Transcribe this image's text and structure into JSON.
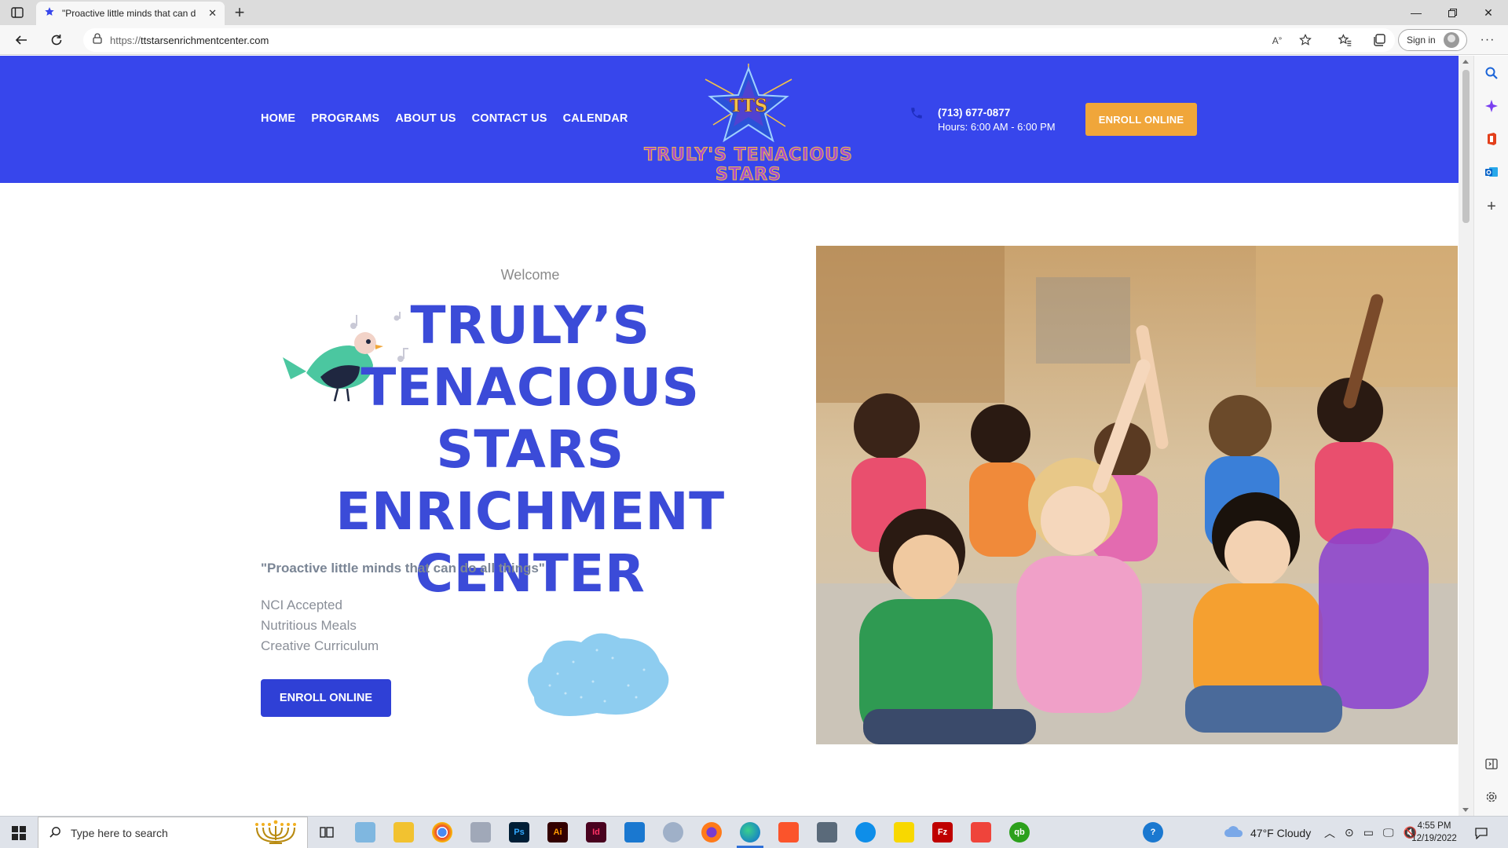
{
  "browser": {
    "tab_title": "\"Proactive little minds that can d",
    "url_host": "ttstarsenrichmentcenter.com",
    "url_scheme": "https://",
    "sign_in": "Sign in",
    "new_tab": "+"
  },
  "site": {
    "nav": [
      "HOME",
      "PROGRAMS",
      "ABOUT US",
      "CONTACT US",
      "CALENDAR"
    ],
    "logo_text": "TRULY'S TENACIOUS STARS",
    "logo_monogram": "TTS",
    "phone": "(713) 677-0877",
    "hours": "Hours: 6:00 AM - 6:00 PM",
    "header_enroll": "ENROLL ONLINE",
    "colors": {
      "header_bg": "#3746ec",
      "title": "#3b4bd8",
      "enroll_orange": "#f0a63a",
      "enroll_blue": "#2f40d6"
    }
  },
  "hero": {
    "welcome": "Welcome",
    "title_lines": [
      "TRULY’S",
      "TENACIOUS STARS",
      "ENRICHMENT",
      "CENTER"
    ],
    "tagline": "\"Proactive little minds that can do all things\"",
    "features": [
      "NCI Accepted",
      "Nutritious Meals",
      "Creative Curriculum"
    ],
    "enroll": "ENROLL ONLINE"
  },
  "taskbar": {
    "search_placeholder": "Type here to search",
    "weather": "47°F  Cloudy",
    "time": "4:55 PM",
    "date": "12/19/2022",
    "apps": [
      "task-view",
      "notepad",
      "file-explorer",
      "chrome",
      "quill",
      "photoshop",
      "illustrator",
      "indesign",
      "mail",
      "paint",
      "firefox",
      "edge",
      "brave",
      "calculator",
      "teamviewer",
      "sticky-notes",
      "filezilla",
      "anydesk",
      "quickbooks"
    ]
  }
}
